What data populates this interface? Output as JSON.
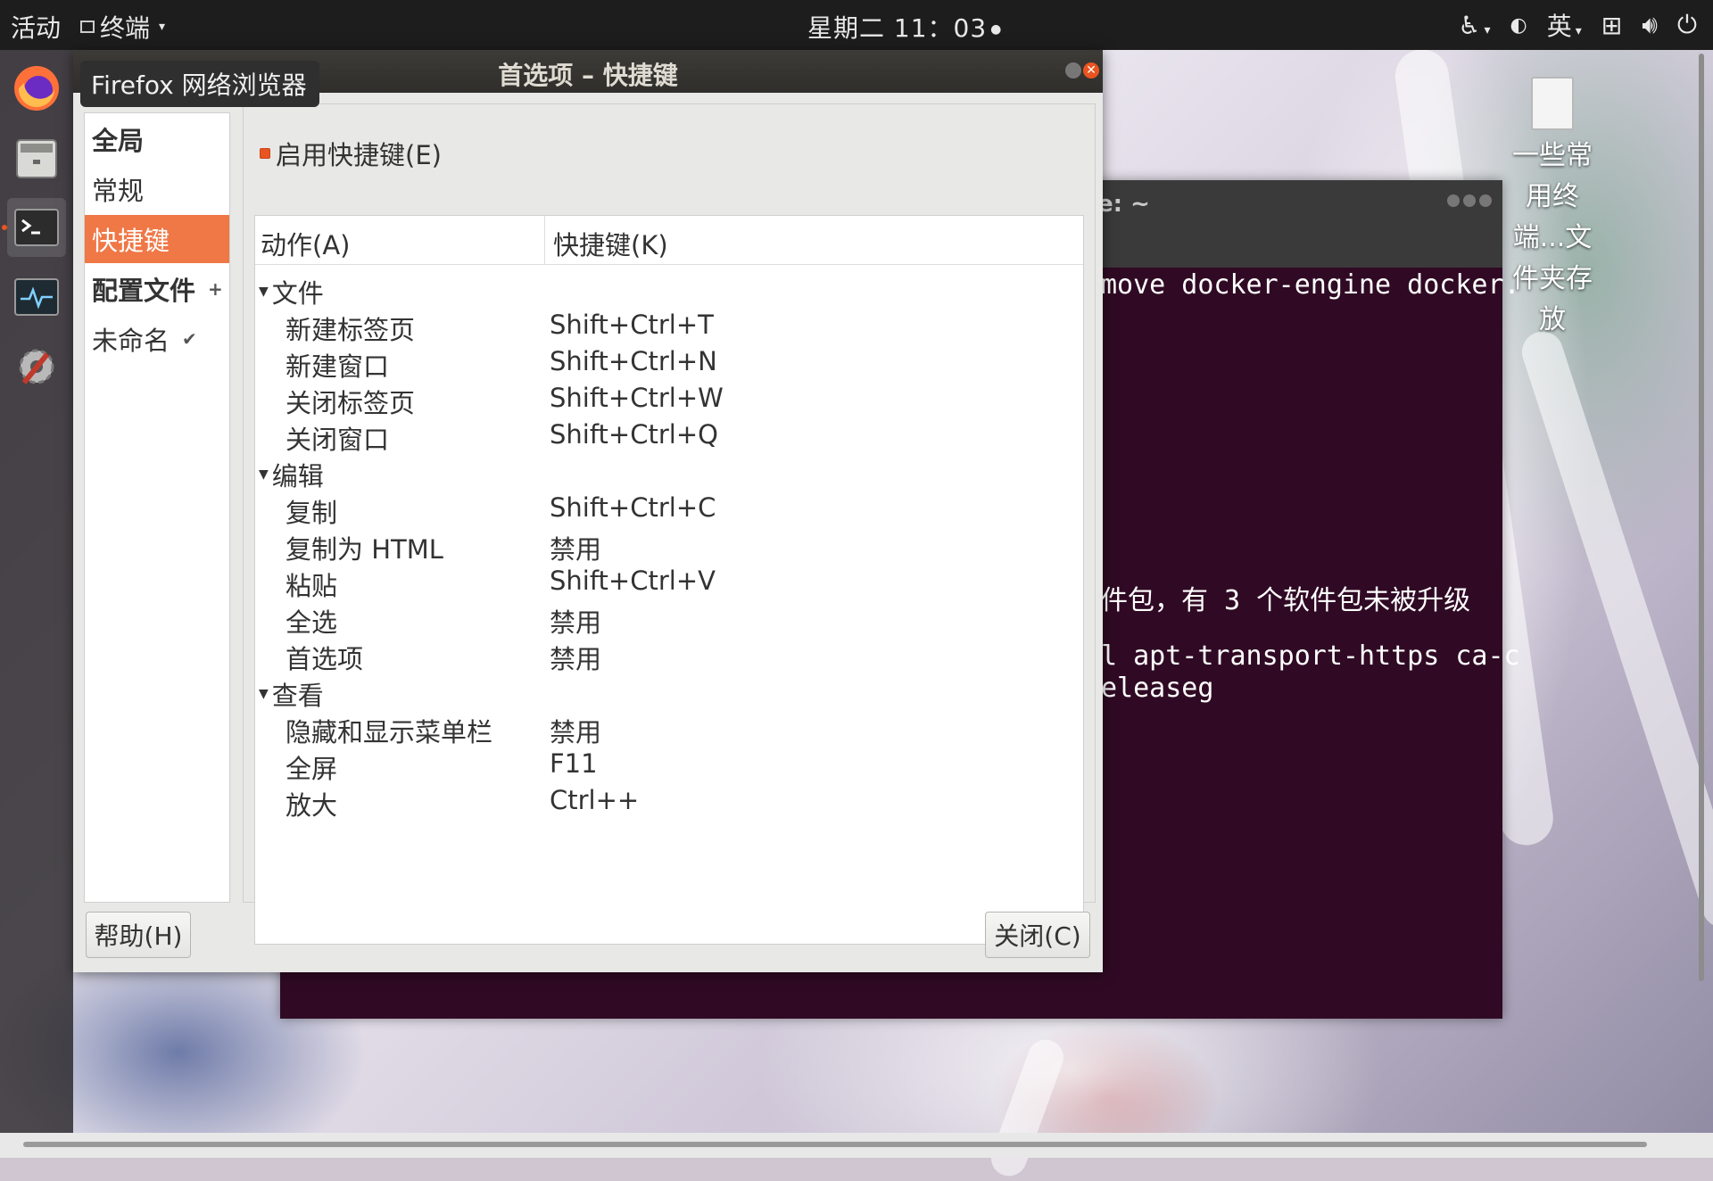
{
  "topbar": {
    "activities": "活动",
    "app_menu": "终端",
    "clock": "星期二 11：03",
    "lang": "英"
  },
  "tooltip": "Firefox 网络浏览器",
  "desktop_icon_label": "一些常用终端...文件夹存放",
  "terminal": {
    "title_fragment": "e: ~",
    "lines": [
      "move docker-engine docker.",
      "件包，有 3 个软件包未被升级",
      "l apt-transport-https ca-c",
      "eleaseg"
    ]
  },
  "dialog": {
    "title": "首选项 – 快捷键",
    "sidebar": [
      {
        "label": "全局",
        "bold": true
      },
      {
        "label": "常规"
      },
      {
        "label": "快捷键",
        "selected": true
      },
      {
        "label": "配置文件",
        "bold": true,
        "extra": "+"
      },
      {
        "label": "未命名",
        "extra": "✔"
      }
    ],
    "enable_label": "启用快捷键(E)",
    "columns": [
      "动作(A)",
      "快捷键(K)"
    ],
    "rows": [
      {
        "category": "文件"
      },
      {
        "action": "新建标签页",
        "key": "Shift+Ctrl+T"
      },
      {
        "action": "新建窗口",
        "key": "Shift+Ctrl+N"
      },
      {
        "action": "关闭标签页",
        "key": "Shift+Ctrl+W"
      },
      {
        "action": "关闭窗口",
        "key": "Shift+Ctrl+Q"
      },
      {
        "category": "编辑"
      },
      {
        "action": "复制",
        "key": "Shift+Ctrl+C"
      },
      {
        "action": "复制为 HTML",
        "key": "禁用"
      },
      {
        "action": "粘贴",
        "key": "Shift+Ctrl+V"
      },
      {
        "action": "全选",
        "key": "禁用"
      },
      {
        "action": "首选项",
        "key": "禁用"
      },
      {
        "category": "查看"
      },
      {
        "action": "隐藏和显示菜单栏",
        "key": "禁用"
      },
      {
        "action": "全屏",
        "key": "F11"
      },
      {
        "action": "放大",
        "key": "Ctrl++"
      }
    ],
    "help_button": "帮助(H)",
    "close_button": "关闭(C)"
  },
  "colors": {
    "accent": "#e95420",
    "selected_row": "#f07746",
    "terminal_bg": "#300a24"
  },
  "dock_icons": [
    "firefox-icon",
    "files-icon",
    "terminal-icon",
    "system-monitor-icon",
    "settings-icon"
  ]
}
